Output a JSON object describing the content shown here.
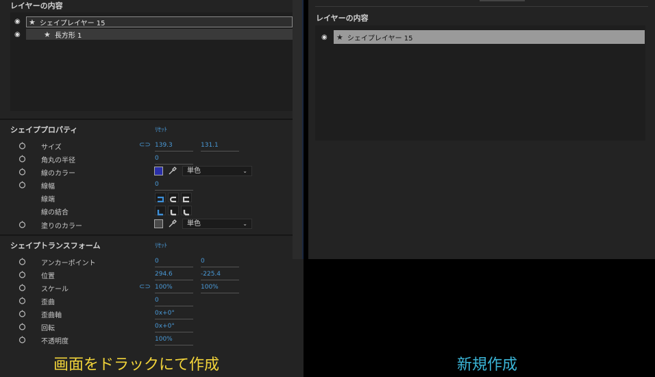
{
  "left": {
    "contents_title": "レイヤーの内容",
    "layers": [
      {
        "label": "シェイプレイヤー 15"
      },
      {
        "label": "長方形 1"
      }
    ],
    "shape_props": {
      "title": "シェイププロパティ",
      "reset": "ﾘｾｯﾄ",
      "size_label": "サイズ",
      "size_w": "139.3",
      "size_h": "131.1",
      "corner_label": "角丸の半径",
      "corner_val": "0",
      "stroke_color_label": "線のカラー",
      "stroke_color": "#2a2fa8",
      "stroke_mode": "単色",
      "stroke_width_label": "線幅",
      "stroke_width_val": "0",
      "cap_label": "線端",
      "join_label": "線の結合",
      "fill_color_label": "塗りのカラー",
      "fill_color": "#4a4a4a",
      "fill_mode": "単色"
    },
    "shape_transform": {
      "title": "シェイプトランスフォーム",
      "reset": "ﾘｾｯﾄ",
      "anchor_label": "アンカーポイント",
      "anchor_x": "0",
      "anchor_y": "0",
      "position_label": "位置",
      "position_x": "294.6",
      "position_y": "-225.4",
      "scale_label": "スケール",
      "scale_x": "100%",
      "scale_y": "100%",
      "skew_label": "歪曲",
      "skew_val": "0",
      "skew_axis_label": "歪曲軸",
      "skew_axis_val": "0x+0°",
      "rotation_label": "回転",
      "rotation_val": "0x+0°",
      "opacity_label": "不透明度",
      "opacity_val": "100%"
    },
    "caption": "画面をドラックにて作成"
  },
  "right": {
    "contents_title": "レイヤーの内容",
    "layers": [
      {
        "label": "シェイプレイヤー 15"
      }
    ],
    "caption": "新規作成"
  },
  "colors": {
    "panel_bg": "#232323",
    "accent_blue": "#4a9ad8",
    "caption_left": "#f2d43a",
    "caption_right": "#3bb6d8"
  }
}
